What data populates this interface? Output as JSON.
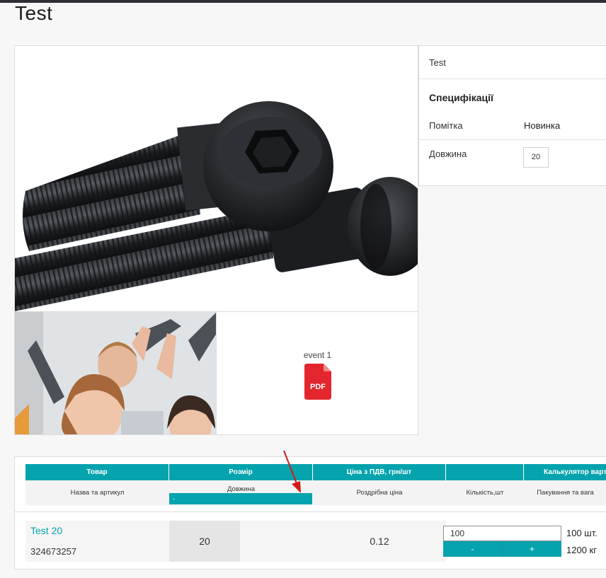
{
  "page": {
    "title": "Test"
  },
  "gallery": {
    "pdf_caption": "event 1",
    "pdf_badge": "PDF"
  },
  "specs": {
    "product_name": "Test",
    "heading": "Специфікації",
    "rows": [
      {
        "label": "Помітка",
        "value": "Новинка"
      },
      {
        "label": "Довжина",
        "value": "20"
      }
    ]
  },
  "table": {
    "headers": [
      "Товар",
      "Розмір",
      "Ціна з ПДВ, грн/шт",
      "",
      "Калькулятор вартості"
    ],
    "subheaders": {
      "product": "Назва та артикул",
      "size": "Довжина",
      "size_select": "-",
      "price": "Роздрібна ціна",
      "quantity": "Кількість,шт",
      "packaging": "Пакування та вага"
    },
    "row": {
      "name": "Test 20",
      "sku": "324673257",
      "size": "20",
      "price": "0.12",
      "quantity": "100",
      "minus": "-",
      "plus": "+",
      "pieces": "100 шт.",
      "weight": "1200 кг"
    }
  },
  "colors": {
    "accent": "#05a3ad",
    "pdf": "#e3262e",
    "arrow": "#d11a1a"
  }
}
